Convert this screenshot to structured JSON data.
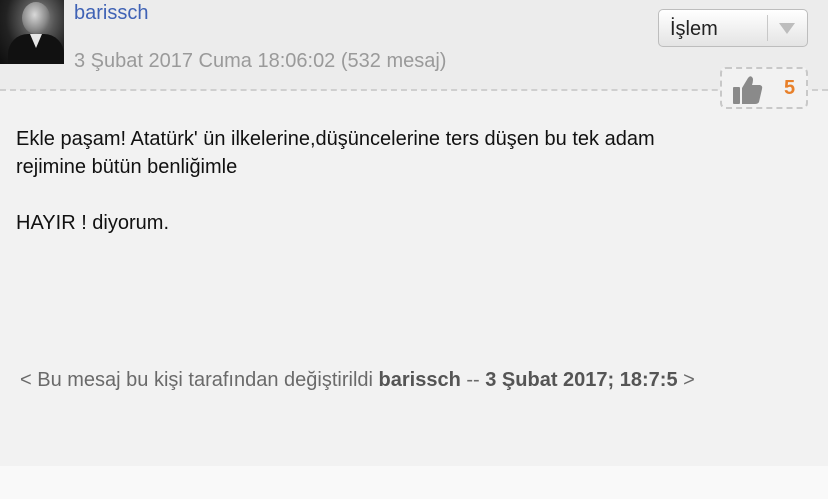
{
  "post": {
    "username": "barissch",
    "meta": "3 Şubat 2017 Cuma 18:06:02 (532 mesaj)",
    "action_select": {
      "selected": "İşlem"
    },
    "likes": {
      "count": "5"
    },
    "body": {
      "line1": "Ekle paşam! Atatürk' ün ilkelerine,düşüncelerine ters düşen bu tek adam",
      "line2": "rejimine bütün benliğimle",
      "line3": "HAYIR ! diyorum."
    },
    "edit_note": {
      "prefix": "< Bu mesaj bu kişi tarafından değiştirildi",
      "editor": "barissch",
      "dash": "--",
      "date": "3 Şubat 2017; 18:7:5",
      "suffix": ">"
    }
  },
  "colors": {
    "username": "#3f62b5",
    "like_count": "#e8802a",
    "meta": "#9a9a9a"
  },
  "icons": {
    "like": "thumbs-up-icon",
    "dropdown": "triangle-down-icon"
  }
}
